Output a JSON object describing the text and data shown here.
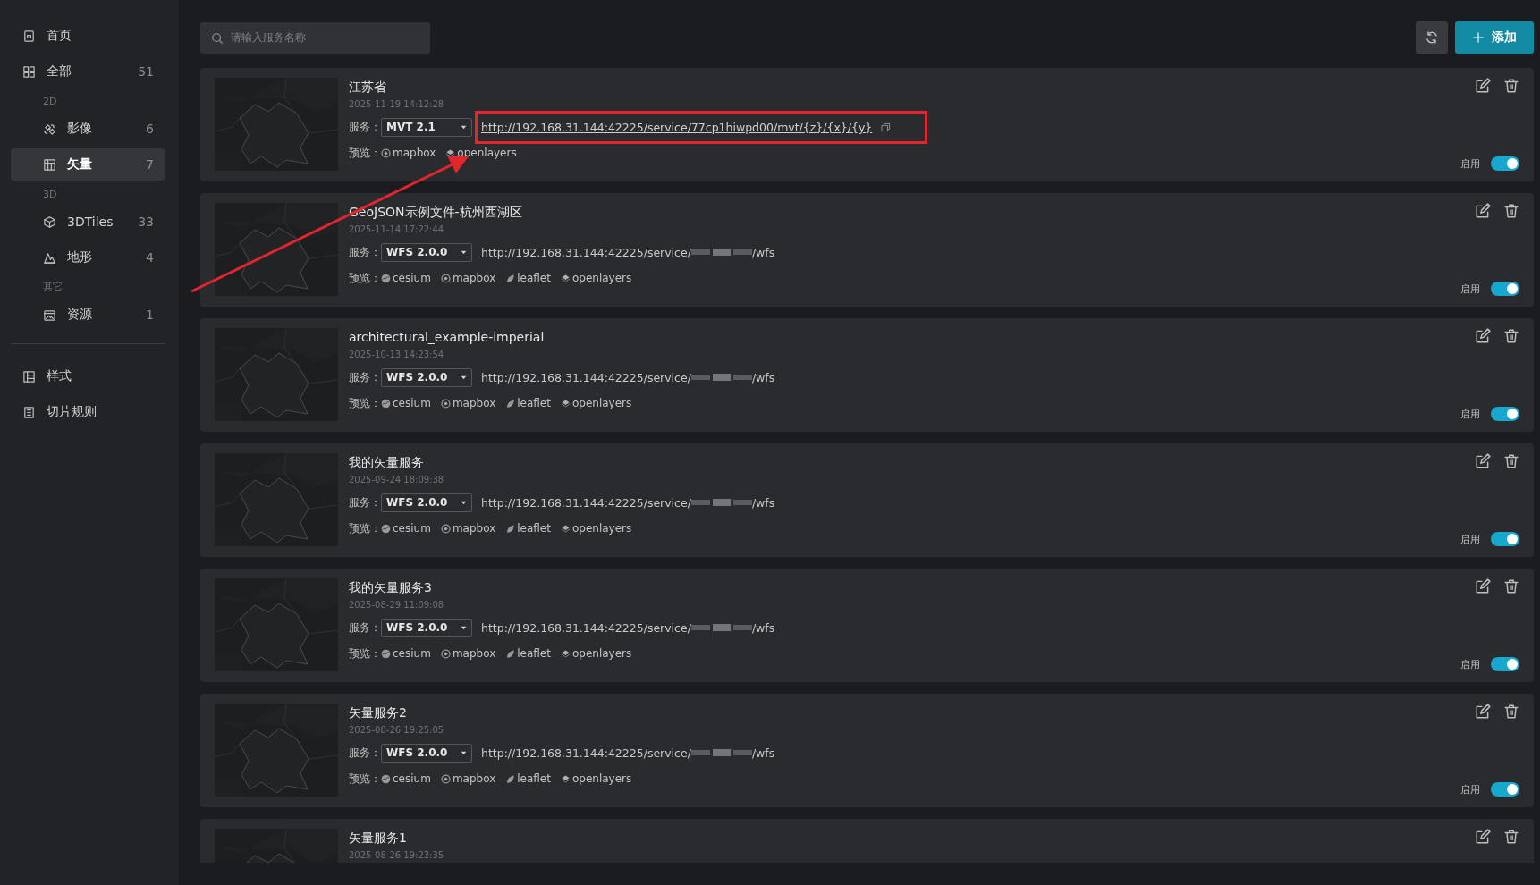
{
  "sidebar": {
    "items": [
      {
        "label": "首页",
        "selected": false
      },
      {
        "label": "全部",
        "count": "51",
        "selected": false,
        "children": [
          {
            "kind": "group",
            "label": "2D",
            "children": [
              {
                "label": "影像",
                "count": "6",
                "selected": false
              },
              {
                "label": "矢量",
                "count": "7",
                "selected": true
              }
            ]
          },
          {
            "kind": "group",
            "label": "3D",
            "children": [
              {
                "label": "3DTiles",
                "count": "33",
                "selected": false
              },
              {
                "label": "地形",
                "count": "4",
                "selected": false
              }
            ]
          },
          {
            "kind": "group",
            "label": "其它",
            "children": [
              {
                "label": "资源",
                "count": "1",
                "selected": false
              }
            ]
          }
        ]
      }
    ],
    "footer_items": [
      {
        "label": "样式",
        "selected": false
      },
      {
        "label": "切片规则",
        "selected": false
      }
    ]
  },
  "toolbar": {
    "search": {
      "placeholder": "请输入服务名称"
    },
    "add_button": "添加"
  },
  "cards": [
    {
      "title": "江苏省",
      "date": "2025-11-19 14:12:28",
      "service_label": "服务：",
      "service": "MVT 2.1",
      "url": "http://192.168.31.144:42225/service/77cp1hiwpd00/mvt/{z}/{x}/{y}",
      "redacted": false,
      "hovered": true,
      "annotated": true,
      "preview_label": "预览：",
      "previews": [
        {
          "kind": "mapbox",
          "label": "mapbox"
        },
        {
          "kind": "openlayers",
          "label": "openlayers"
        }
      ],
      "enabled_label": "启用",
      "enabled": true
    },
    {
      "title": "GeoJSON示例文件-杭州西湖区",
      "date": "2025-11-14 17:22:44",
      "service_label": "服务：",
      "service": "WFS 2.0.0",
      "url": "http://192.168.31.144:42225/service/",
      "url_end": "/wfs",
      "redacted": true,
      "hovered": false,
      "annotated": false,
      "preview_label": "预览：",
      "previews": [
        {
          "kind": "cesium",
          "label": "cesium"
        },
        {
          "kind": "mapbox",
          "label": "mapbox"
        },
        {
          "kind": "leaflet",
          "label": "leaflet"
        },
        {
          "kind": "openlayers",
          "label": "openlayers"
        }
      ],
      "enabled_label": "启用",
      "enabled": true
    },
    {
      "title": "architectural_example-imperial",
      "date": "2025-10-13 14:23:54",
      "service_label": "服务：",
      "service": "WFS 2.0.0",
      "url": "http://192.168.31.144:42225/service/",
      "url_end": "/wfs",
      "redacted": true,
      "hovered": false,
      "annotated": false,
      "preview_label": "预览：",
      "previews": [
        {
          "kind": "cesium",
          "label": "cesium"
        },
        {
          "kind": "mapbox",
          "label": "mapbox"
        },
        {
          "kind": "leaflet",
          "label": "leaflet"
        },
        {
          "kind": "openlayers",
          "label": "openlayers"
        }
      ],
      "enabled_label": "启用",
      "enabled": true
    },
    {
      "title": "我的矢量服务",
      "date": "2025-09-24 18:09:38",
      "service_label": "服务：",
      "service": "WFS 2.0.0",
      "url": "http://192.168.31.144:42225/service/",
      "url_end": "/wfs",
      "redacted": true,
      "hovered": false,
      "annotated": false,
      "preview_label": "预览：",
      "previews": [
        {
          "kind": "cesium",
          "label": "cesium"
        },
        {
          "kind": "mapbox",
          "label": "mapbox"
        },
        {
          "kind": "leaflet",
          "label": "leaflet"
        },
        {
          "kind": "openlayers",
          "label": "openlayers"
        }
      ],
      "enabled_label": "启用",
      "enabled": true
    },
    {
      "title": "我的矢量服务3",
      "date": "2025-08-29 11:09:08",
      "service_label": "服务：",
      "service": "WFS 2.0.0",
      "url": "http://192.168.31.144:42225/service/",
      "url_end": "/wfs",
      "redacted": true,
      "hovered": false,
      "annotated": false,
      "preview_label": "预览：",
      "previews": [
        {
          "kind": "cesium",
          "label": "cesium"
        },
        {
          "kind": "mapbox",
          "label": "mapbox"
        },
        {
          "kind": "leaflet",
          "label": "leaflet"
        },
        {
          "kind": "openlayers",
          "label": "openlayers"
        }
      ],
      "enabled_label": "启用",
      "enabled": true
    },
    {
      "title": "矢量服务2",
      "date": "2025-08-26 19:25:05",
      "service_label": "服务：",
      "service": "WFS 2.0.0",
      "url": "http://192.168.31.144:42225/service/",
      "url_end": "/wfs",
      "redacted": true,
      "hovered": false,
      "annotated": false,
      "preview_label": "预览：",
      "previews": [
        {
          "kind": "cesium",
          "label": "cesium"
        },
        {
          "kind": "mapbox",
          "label": "mapbox"
        },
        {
          "kind": "leaflet",
          "label": "leaflet"
        },
        {
          "kind": "openlayers",
          "label": "openlayers"
        }
      ],
      "enabled_label": "启用",
      "enabled": true
    },
    {
      "title": "矢量服务1",
      "date": "2025-08-26 19:23:35"
    }
  ],
  "annotation": {
    "kind": "arrow"
  }
}
